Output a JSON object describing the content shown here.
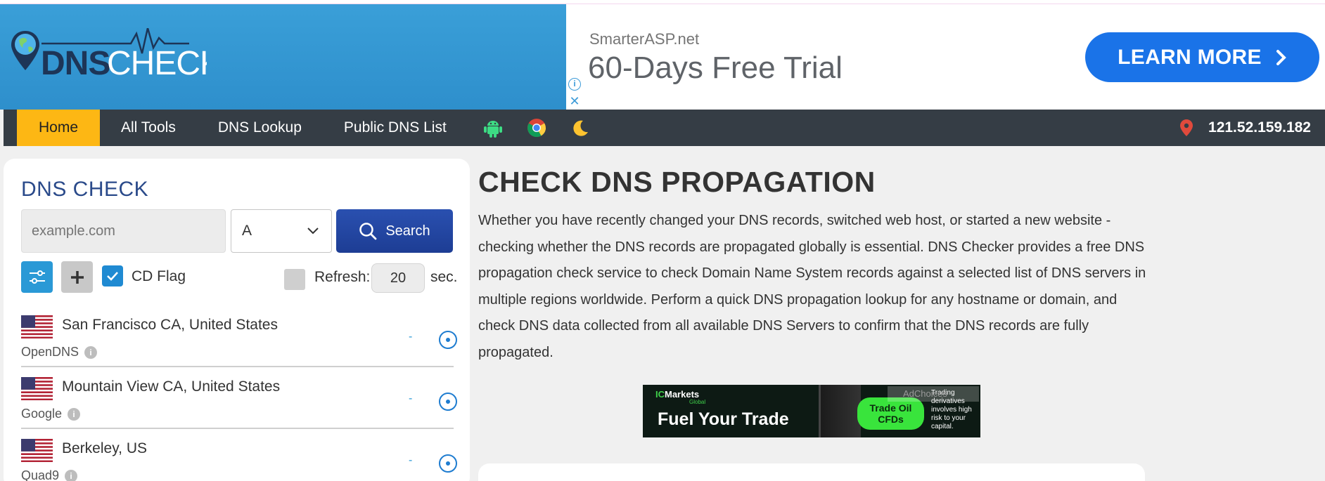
{
  "brand": {
    "logo_text": "DNSCHECKER"
  },
  "ad_top": {
    "advertiser": "SmarterASP.net",
    "headline": "60-Days Free Trial",
    "cta": "LEARN MORE",
    "cta_color": "#1a73e8"
  },
  "nav": {
    "items": [
      {
        "label": "Home",
        "active": true
      },
      {
        "label": "All Tools"
      },
      {
        "label": "DNS Lookup"
      },
      {
        "label": "Public DNS List"
      }
    ],
    "icons": [
      "android-icon",
      "chrome-icon",
      "moon-icon"
    ],
    "ip": "121.52.159.182",
    "accent": "#fdb714"
  },
  "dns_check": {
    "title": "DNS CHECK",
    "domain_placeholder": "example.com",
    "record_type": "A",
    "search_label": "Search",
    "cd_flag_label": "CD Flag",
    "cd_flag_checked": true,
    "refresh_label": "Refresh:",
    "refresh_checked": false,
    "refresh_value": "20",
    "refresh_unit": "sec.",
    "servers": [
      {
        "location": "San Francisco CA, United States",
        "provider": "OpenDNS",
        "status": "-",
        "flag": "us-flag"
      },
      {
        "location": "Mountain View CA, United States",
        "provider": "Google",
        "status": "-",
        "flag": "us-flag"
      },
      {
        "location": "Berkeley, US",
        "provider": "Quad9",
        "status": "-",
        "flag": "us-flag"
      }
    ]
  },
  "main": {
    "title": "CHECK DNS PROPAGATION",
    "description": "Whether you have recently changed your DNS records, switched web host, or started a new website - checking whether the DNS records are propagated globally is essential. DNS Checker provides a free DNS propagation check service to check Domain Name System records against a selected list of DNS servers in multiple regions worldwide. Perform a quick DNS propagation lookup for any hostname or domain, and check DNS data collected from all available DNS Servers to confirm that the DNS records are fully propagated."
  },
  "ad_banner": {
    "logo_ic": "IC",
    "logo_rest": "Markets",
    "logo_sub": "Global",
    "headline": "Fuel Your Trade",
    "cta": "Trade Oil CFDs",
    "disclaimer": "Trading derivatives involves high risk to your capital.",
    "ad_choices": "AdChoices"
  }
}
